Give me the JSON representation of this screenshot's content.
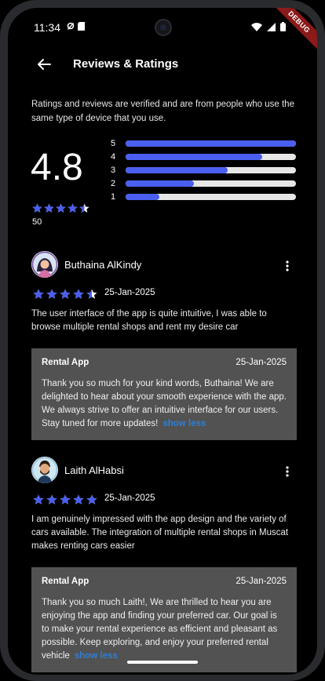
{
  "status_bar": {
    "time": "11:34"
  },
  "debug_banner": "DEBUG",
  "app_bar": {
    "title": "Reviews & Ratings",
    "back_icon": "arrow-left-icon"
  },
  "intro_text": "Ratings and reviews are verified and are from people who use the same type of device that you use.",
  "summary": {
    "average": "4.8",
    "stars": 4.5,
    "count": "50",
    "distribution": [
      {
        "label": "5",
        "fraction": 1.0
      },
      {
        "label": "4",
        "fraction": 0.8
      },
      {
        "label": "3",
        "fraction": 0.6
      },
      {
        "label": "2",
        "fraction": 0.4
      },
      {
        "label": "1",
        "fraction": 0.2
      }
    ]
  },
  "reviews": [
    {
      "name": "Buthaina AlKindy",
      "stars": 4.5,
      "date": "25-Jan-2025",
      "text": "The user interface of the app is quite intuitive, I was able to browse multiple rental shops and rent my desire car",
      "reply": {
        "author": "Rental App",
        "date": "25-Jan-2025",
        "text": "Thank you so much for your kind words, Buthaina! We are delighted to hear about your smooth experience with the app. We always strive to offer an intuitive interface for our users. Stay tuned for more updates!",
        "toggle": "show less"
      }
    },
    {
      "name": "Laith AlHabsi",
      "stars": 5,
      "date": "25-Jan-2025",
      "text": "I am genuinely impressed with the app design and the variety of cars available. The integration of multiple rental shops in Muscat makes renting cars easier",
      "reply": {
        "author": "Rental App",
        "date": "25-Jan-2025",
        "text": "Thank you so much Laith!, We are thrilled to hear you are enjoying the app and finding your preferred car. Our goal is to make your rental experience as efficient and pleasant as possible. Keep exploring, and enjoy your preferred rental vehicle",
        "toggle": "show less"
      }
    }
  ],
  "colors": {
    "accent": "#4a5ff0",
    "star": "#4a5ff0",
    "reply_bg": "#525252",
    "link": "#2e7fd6"
  }
}
